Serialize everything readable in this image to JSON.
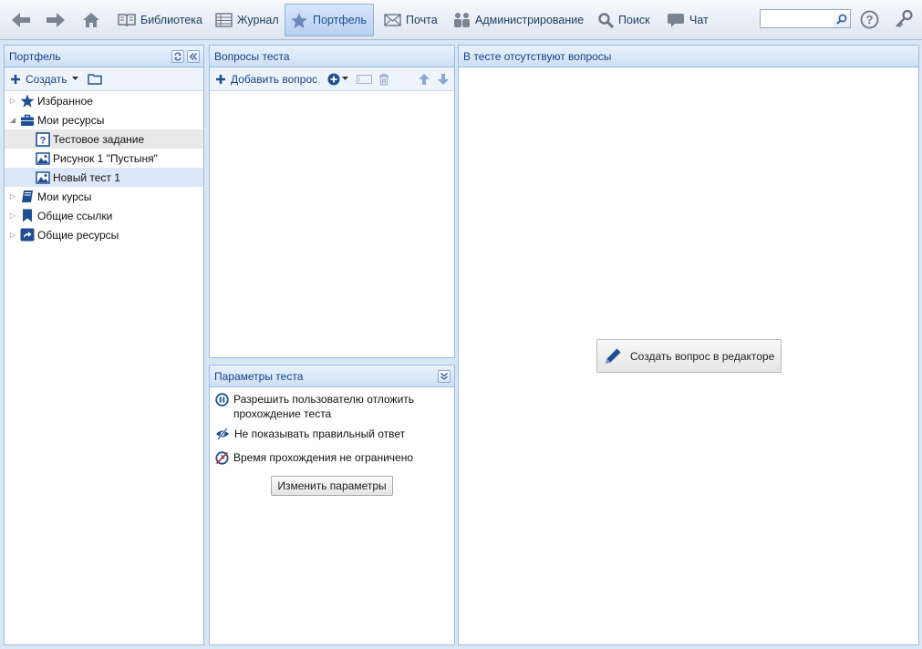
{
  "toolbar": {
    "library": "Библиотека",
    "journal": "Журнал",
    "portfolio": "Портфель",
    "mail": "Почта",
    "admin": "Администрирование",
    "search": "Поиск",
    "chat": "Чат",
    "search_value": ""
  },
  "portfolio_panel": {
    "title": "Портфель",
    "create_label": "Создать",
    "tree": [
      {
        "label": "Избранное"
      },
      {
        "label": "Мои ресурсы"
      },
      {
        "label": "Тестовое задание"
      },
      {
        "label": "Рисунок 1 \"Пустыня\""
      },
      {
        "label": "Новый тест 1"
      },
      {
        "label": "Мои курсы"
      },
      {
        "label": "Общие ссылки"
      },
      {
        "label": "Общие ресурсы"
      }
    ]
  },
  "questions_panel": {
    "title": "Вопросы теста",
    "add_question": "Добавить вопрос"
  },
  "params_panel": {
    "title": "Параметры теста",
    "items": [
      "Разрешить пользователю отложить прохождение теста",
      "Не показывать правильный ответ",
      "Время прохождения не ограничено"
    ],
    "change_button": "Изменить параметры"
  },
  "right_panel": {
    "title": "В тесте отсутствуют вопросы",
    "create_button": "Создать вопрос в редакторе"
  },
  "colors": {
    "header_text": "#15428b",
    "accent": "#1f4f93",
    "border": "#99bbe8"
  }
}
